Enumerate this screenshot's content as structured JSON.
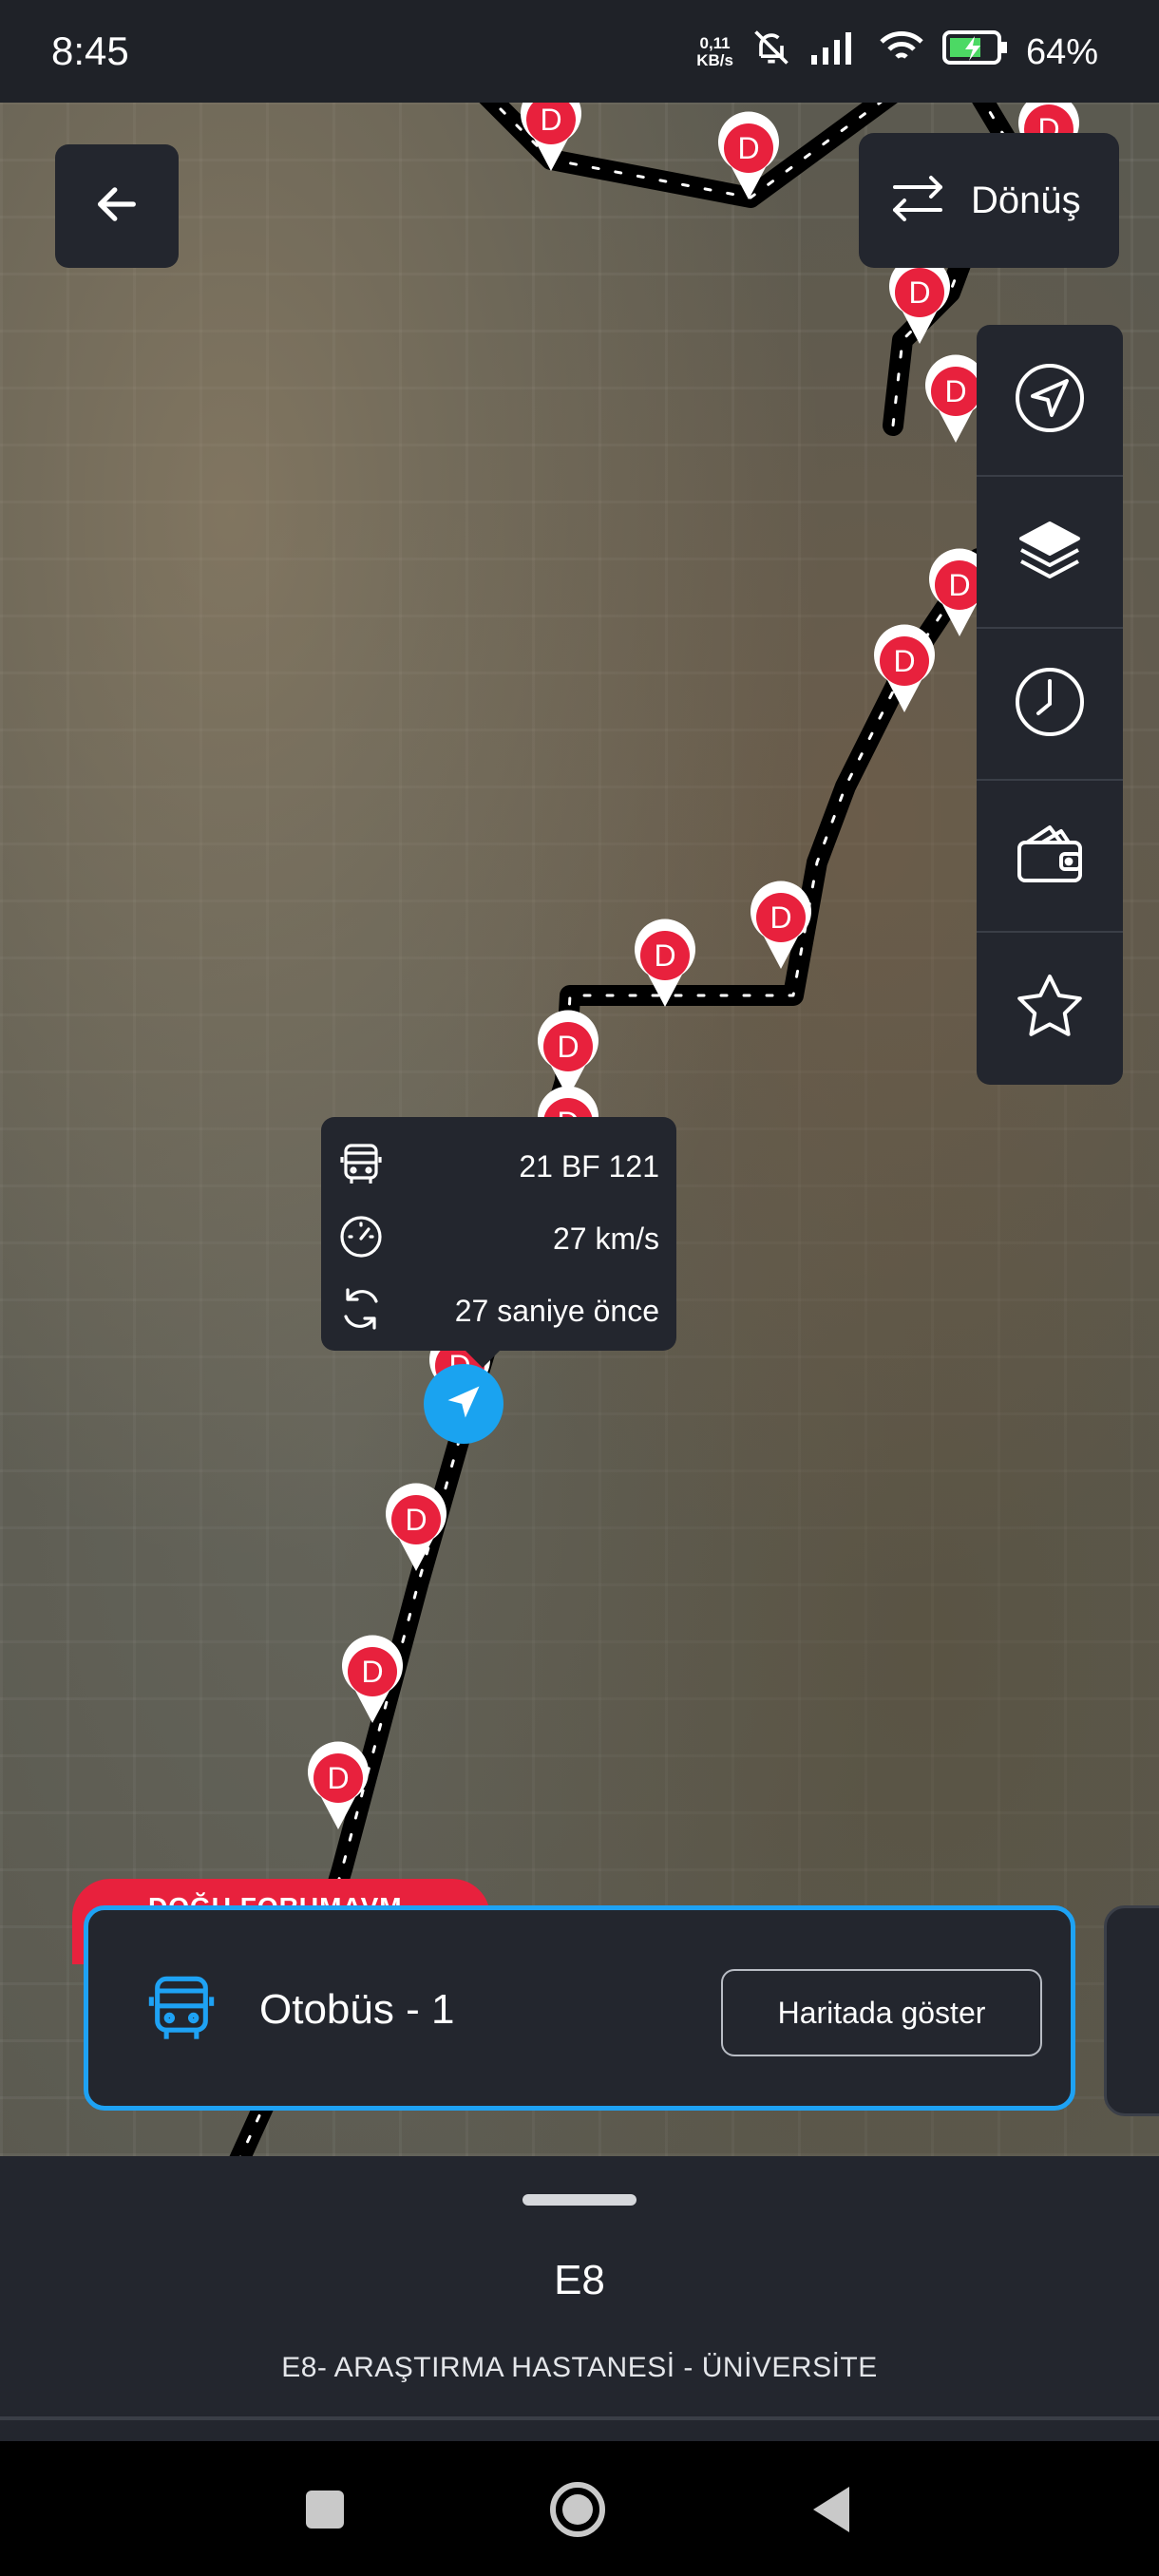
{
  "status_bar": {
    "time": "8:45",
    "net_speed_value": "0,11",
    "net_speed_unit": "KB/s",
    "battery": "64%"
  },
  "header": {
    "back_icon": "arrow-left-icon",
    "direction_label": "Dönüş",
    "direction_icon": "swap-arrows-icon"
  },
  "map_tools": [
    {
      "name": "locate",
      "icon": "navigation-arrow-icon"
    },
    {
      "name": "layers",
      "icon": "layers-icon"
    },
    {
      "name": "schedule",
      "icon": "clock-icon"
    },
    {
      "name": "wallet",
      "icon": "wallet-icon"
    },
    {
      "name": "favorite",
      "icon": "star-icon"
    }
  ],
  "stop_marker_letter": "D",
  "vehicle_popup": {
    "plate": "21 BF 121",
    "speed": "27 km/s",
    "updated": "27 saniye önce"
  },
  "stop_label_partial": "DOĞU FORUMAVM",
  "vehicle_card": {
    "title": "Otobüs - 1",
    "button": "Haritada göster"
  },
  "route": {
    "code": "E8",
    "name": "E8- ARAŞTIRMA HASTANESİ - ÜNİVERSİTE"
  },
  "colors": {
    "accent_blue": "#1ea2f4",
    "stop_red": "#e8213d",
    "panel_dark": "#23262e"
  }
}
